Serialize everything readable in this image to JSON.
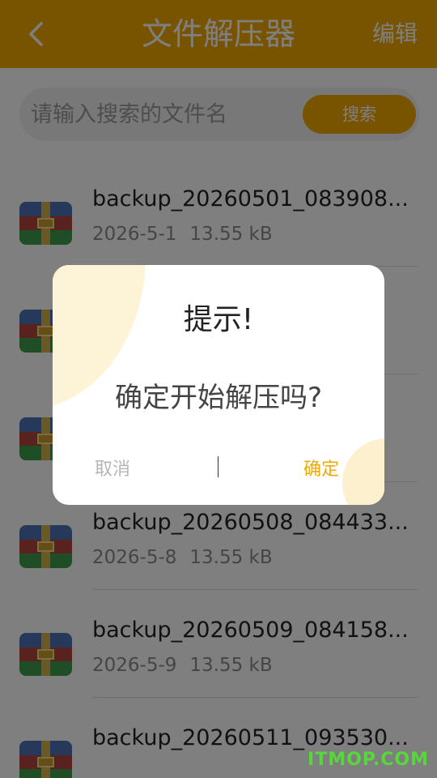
{
  "header": {
    "title": "文件解压器",
    "edit_label": "编辑"
  },
  "search": {
    "placeholder": "请输入搜索的文件名",
    "button_label": "搜索"
  },
  "files": [
    {
      "name": "backup_20260501_083908...",
      "date": "2026-5-1",
      "size": "13.55 kB"
    },
    {
      "name": "",
      "date": "",
      "size": ""
    },
    {
      "name": "",
      "date": "",
      "size": ""
    },
    {
      "name": "backup_20260508_084433...",
      "date": "2026-5-8",
      "size": "13.55 kB"
    },
    {
      "name": "backup_20260509_084158...",
      "date": "2026-5-9",
      "size": "13.55 kB"
    },
    {
      "name": "backup_20260511_093530...",
      "date": "",
      "size": ""
    }
  ],
  "dialog": {
    "title": "提示!",
    "message": "确定开始解压吗?",
    "cancel_label": "取消",
    "confirm_label": "确定"
  },
  "watermark": "ITMOP.COM",
  "colors": {
    "accent": "#f2a900",
    "mask": "rgba(0,0,0,0.5)"
  },
  "icons": {
    "back": "chevron-left-icon",
    "file": "archive-file-icon"
  }
}
